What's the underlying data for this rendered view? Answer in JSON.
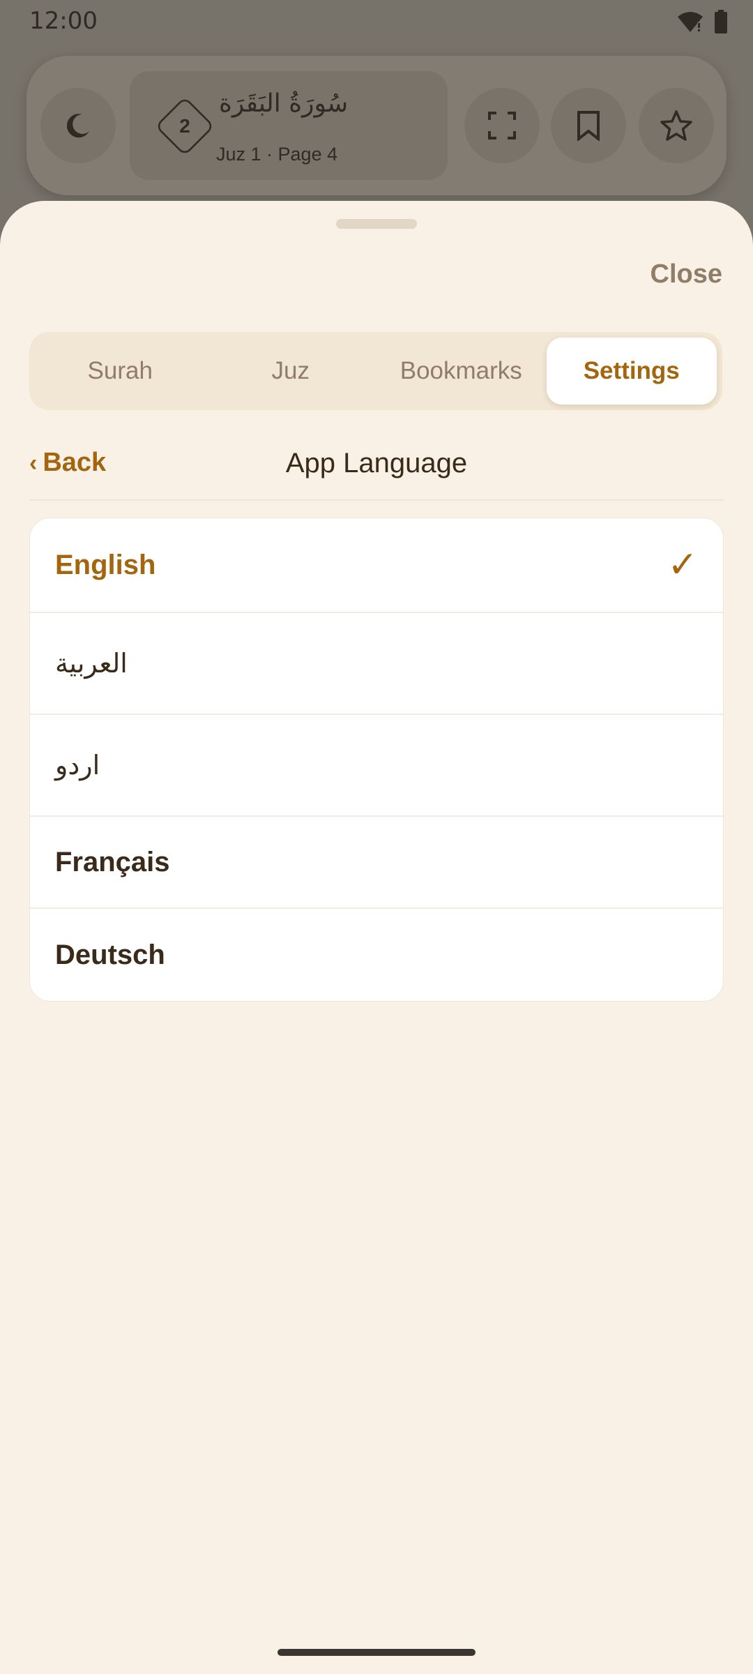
{
  "status_bar": {
    "time": "12:00",
    "icons": [
      "wifi-icon",
      "battery-icon"
    ]
  },
  "reader_bar": {
    "juz_number": "2",
    "surah_name_ar": "سُورَةُ البَقَرَة",
    "subtitle": "Juz 1 · Page 4",
    "buttons": [
      "moon-icon",
      "fullscreen-icon",
      "bookmark-icon",
      "star-icon"
    ]
  },
  "sheet": {
    "close_label": "Close",
    "tabs": [
      {
        "label": "Surah"
      },
      {
        "label": "Juz"
      },
      {
        "label": "Bookmarks"
      },
      {
        "label": "Settings"
      }
    ],
    "active_tab": "Settings",
    "back_label": "Back",
    "title": "App Language",
    "languages": [
      {
        "label": "English",
        "selected": true
      },
      {
        "label": "العربية",
        "selected": false
      },
      {
        "label": "اردو",
        "selected": false
      },
      {
        "label": "Français",
        "selected": false
      },
      {
        "label": "Deutsch",
        "selected": false
      }
    ],
    "check_glyph": "✓"
  },
  "colors": {
    "accent": "#a3650e",
    "sheet_bg": "#f9f1e5",
    "tab_bg": "#f2e6d4",
    "text_dark": "#3a2a1a",
    "muted": "#8f7d68",
    "scrim": "#77726a"
  }
}
